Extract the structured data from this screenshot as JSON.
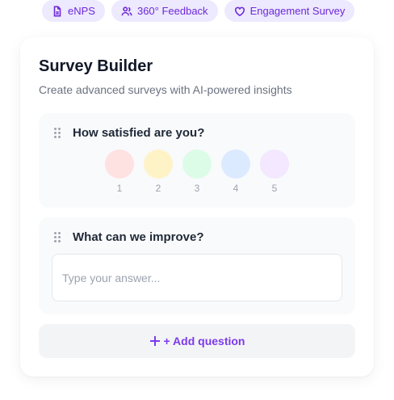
{
  "tags": [
    {
      "label": "eNPS",
      "icon": "document-icon"
    },
    {
      "label": "360° Feedback",
      "icon": "users-icon"
    },
    {
      "label": "Engagement Survey",
      "icon": "heart-icon"
    }
  ],
  "builder": {
    "title": "Survey Builder",
    "subtitle": "Create advanced surveys with AI-powered insights"
  },
  "questions": [
    {
      "label": "How satisfied are you?",
      "type": "rating",
      "options": [
        {
          "value": "1",
          "color": "#fee2e2"
        },
        {
          "value": "2",
          "color": "#fef3c7"
        },
        {
          "value": "3",
          "color": "#dcfce7"
        },
        {
          "value": "4",
          "color": "#dbeafe"
        },
        {
          "value": "5",
          "color": "#f3e8ff"
        }
      ]
    },
    {
      "label": "What can we improve?",
      "type": "text",
      "placeholder": "Type your answer...",
      "value": ""
    }
  ],
  "add_question": {
    "icon": "plus-icon",
    "label": "+ Add question"
  },
  "colors": {
    "accent": "#7c3aed",
    "chip_bg": "#ede9fe"
  }
}
